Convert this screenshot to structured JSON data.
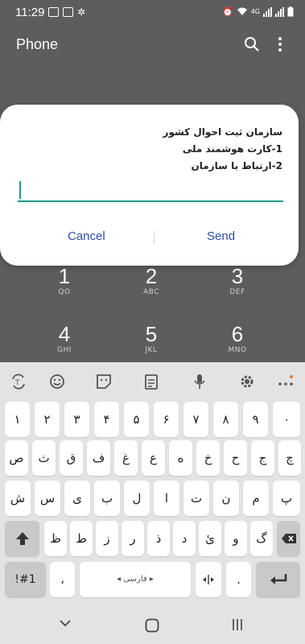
{
  "status_bar": {
    "time": "11:29",
    "network": "4G"
  },
  "app": {
    "title": "Phone",
    "icons": [
      "search-icon",
      "more-vert-icon"
    ]
  },
  "dialpad": [
    {
      "digit": "1",
      "letters": "QO"
    },
    {
      "digit": "2",
      "letters": "ABC"
    },
    {
      "digit": "3",
      "letters": "DEF"
    },
    {
      "digit": "4",
      "letters": "GHI"
    },
    {
      "digit": "5",
      "letters": "JKL"
    },
    {
      "digit": "6",
      "letters": "MNO"
    }
  ],
  "dialog": {
    "line1": "سازمان ثبت احوال کشور",
    "line2": "1-کارت هوشمند ملی",
    "line3": "2-ارتباط با سازمان",
    "input_value": "",
    "cancel_label": "Cancel",
    "send_label": "Send"
  },
  "keyboard": {
    "toolbar_icons": [
      "translate-icon",
      "emoji-icon",
      "sticker-icon",
      "clipboard-icon",
      "mic-icon",
      "settings-icon",
      "more-icon"
    ],
    "digits": [
      "١",
      "٢",
      "٣",
      "۴",
      "۵",
      "۶",
      "٧",
      "٨",
      "٩",
      "٠"
    ],
    "row1": [
      "ص",
      "ث",
      "ق",
      "ف",
      "غ",
      "ع",
      "ه",
      "خ",
      "ح",
      "ج",
      "چ"
    ],
    "row2": [
      "ش",
      "س",
      "ی",
      "ب",
      "ل",
      "ا",
      "ت",
      "ن",
      "م",
      "پ"
    ],
    "row3": [
      "ظ",
      "ط",
      "ز",
      "ر",
      "ذ",
      "د",
      "ئ",
      "و",
      "گ",
      "ک"
    ],
    "bottom": {
      "symbols_label": "!#1",
      "comma": "،",
      "space_label": "فارسی",
      "period": "."
    }
  },
  "accent_color": "#1e9a8e",
  "button_color": "#2b4fa3"
}
